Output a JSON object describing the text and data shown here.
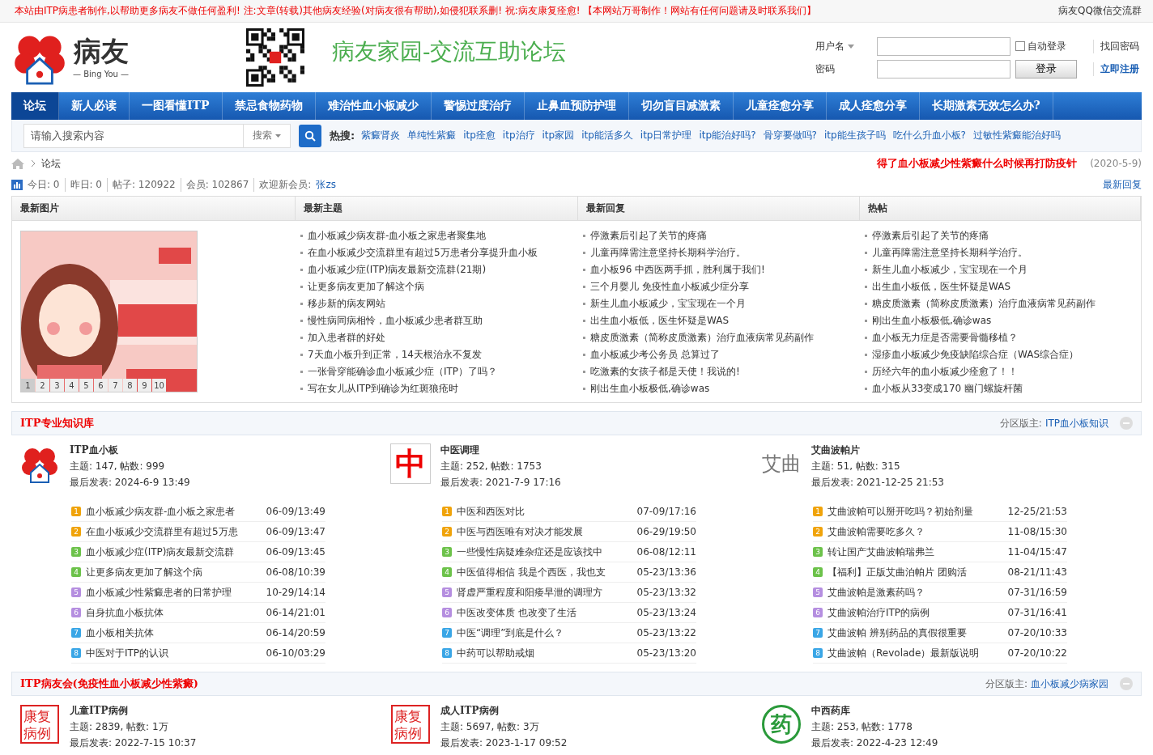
{
  "top_notice": "本站由ITP病患者制作,以帮助更多病友不做任何盈利! 注:文章(转载)其他病友经验(对病友很有帮助),如侵犯联系删! 祝:病友康复痊愈! 【本网站万哥制作！网站有任何问题请及时联系我们】",
  "top_link": "病友QQ微信交流群",
  "logo": {
    "name": "病友",
    "sub": "— Bing You —"
  },
  "site_title": "病友家园-交流互助论坛",
  "login": {
    "user_label": "用户名",
    "pass_label": "密码",
    "auto_login": "自动登录",
    "auto_checked": false,
    "submit": "登录",
    "forgot": "找回密码",
    "register": "立即注册"
  },
  "nav": [
    {
      "label": "论坛",
      "selected": true
    },
    {
      "label": "新人必读",
      "selected": false
    },
    {
      "label": "一图看懂ITP",
      "selected": false
    },
    {
      "label": "禁忌食物药物",
      "selected": false
    },
    {
      "label": "难治性血小板减少",
      "selected": false
    },
    {
      "label": "警惕过度治疗",
      "selected": false
    },
    {
      "label": "止鼻血预防护理",
      "selected": false
    },
    {
      "label": "切勿盲目减激素",
      "selected": false
    },
    {
      "label": "儿童痊愈分享",
      "selected": false
    },
    {
      "label": "成人痊愈分享",
      "selected": false
    },
    {
      "label": "长期激素无效怎么办?",
      "selected": false
    }
  ],
  "search": {
    "placeholder": "请输入搜索内容",
    "scope": "搜索",
    "hot_label": "热搜:",
    "hot": [
      "紫癜肾炎",
      "单纯性紫癜",
      "itp痊愈",
      "itp治疗",
      "itp家园",
      "itp能活多久",
      "itp日常护理",
      "itp能治好吗?",
      "骨穿要做吗?",
      "itp能生孩子吗",
      "吃什么升血小板?",
      "过敏性紫癜能治好吗"
    ]
  },
  "breadcrumb": {
    "current": "论坛",
    "headline": "得了血小板减少性紫癜什么时候再打防疫针",
    "headline_date": "(2020-5-9)"
  },
  "stats": [
    "今日: 0",
    "昨日: 0",
    "帖子: 120922",
    "会员: 102867"
  ],
  "new_member_label": "欢迎新会员:",
  "new_member": "张zs",
  "latest_replies_link": "最新回复",
  "latest": {
    "columns": [
      "最新图片",
      "最新主题",
      "最新回复",
      "热帖"
    ],
    "pager": [
      {
        "label": "1",
        "selected": true
      },
      {
        "label": "2",
        "selected": false
      },
      {
        "label": "3",
        "selected": false
      },
      {
        "label": "4",
        "selected": false
      },
      {
        "label": "5",
        "selected": false
      },
      {
        "label": "6",
        "selected": false
      },
      {
        "label": "7",
        "selected": false
      },
      {
        "label": "8",
        "selected": false
      },
      {
        "label": "9",
        "selected": false
      },
      {
        "label": "10",
        "selected": false
      }
    ],
    "lists": [
      [
        "血小板减少病友群-血小板之家患者聚集地",
        "在血小板减少交流群里有超过5万患者分享提升血小板",
        "血小板减少症(ITP)病友最新交流群(21期)",
        "让更多病友更加了解这个病",
        "移步新的病友网站",
        "慢性病同病相怜，血小板减少患者群互助",
        "加入患者群的好处",
        "7天血小板升到正常，14天根治永不复发",
        "一张骨穿能确诊血小板减少症（ITP）了吗？",
        "写在女儿从ITP到确诊为红斑狼疮时"
      ],
      [
        "停激素后引起了关节的疼痛",
        "儿童再障需注意坚持长期科学治疗。",
        "血小板96 中西医两手抓，胜利属于我们!",
        "三个月婴儿 免疫性血小板减少症分享",
        "新生儿血小板减少，宝宝现在一个月",
        "出生血小板低，医生怀疑是WAS",
        "糖皮质激素（简称皮质激素）治疗血液病常见药副作",
        "血小板减少考公务员 总算过了",
        "吃激素的女孩子都是天使！我说的!",
        "刚出生血小板极低,确诊was"
      ],
      [
        "停激素后引起了关节的疼痛",
        "儿童再障需注意坚持长期科学治疗。",
        "新生儿血小板减少，宝宝现在一个月",
        "出生血小板低，医生怀疑是WAS",
        "糖皮质激素（简称皮质激素）治疗血液病常见药副作",
        "刚出生血小板极低,确诊was",
        "血小板无力症是否需要骨髓移植？",
        "湿疹血小板减少免疫缺陷综合症（WAS综合症）",
        "历经六年的血小板减少痊愈了！！",
        "血小板从33变成170 幽门螺旋杆菌"
      ]
    ]
  },
  "sections": [
    {
      "title": "ITP专业知识库",
      "moderator_label": "分区版主:",
      "moderator": "ITP血小板知识",
      "forums": [
        {
          "icon": {
            "kind": "logo"
          },
          "name": "ITP血小板",
          "stats": "主题: 147, 帖数: 999",
          "last": "最后发表: 2024-6-9 13:49",
          "threads": [
            {
              "rank": "1",
              "color": "#f0a30a",
              "title": "血小板减少病友群-血小板之家患者",
              "time": "06-09/13:49"
            },
            {
              "rank": "2",
              "color": "#f0a30a",
              "title": "在血小板减少交流群里有超过5万患",
              "time": "06-09/13:47"
            },
            {
              "rank": "3",
              "color": "#6cc24a",
              "title": "血小板减少症(ITP)病友最新交流群",
              "time": "06-09/13:45"
            },
            {
              "rank": "4",
              "color": "#6cc24a",
              "title": "让更多病友更加了解这个病",
              "time": "06-08/10:39"
            },
            {
              "rank": "5",
              "color": "#b58ee0",
              "title": "血小板减少性紫癜患者的日常护理",
              "time": "10-29/14:14"
            },
            {
              "rank": "6",
              "color": "#b58ee0",
              "title": "自身抗血小板抗体",
              "time": "06-14/21:01"
            },
            {
              "rank": "7",
              "color": "#3aa6e6",
              "title": "血小板相关抗体",
              "time": "06-14/20:59"
            },
            {
              "rank": "8",
              "color": "#3aa6e6",
              "title": "中医对于ITP的认识",
              "time": "06-10/03:29"
            }
          ]
        },
        {
          "icon": {
            "kind": "tile",
            "text": "中"
          },
          "name": "中医调理",
          "stats": "主题: 252, 帖数: 1753",
          "last": "最后发表: 2021-7-9 17:16",
          "threads": [
            {
              "rank": "1",
              "color": "#f0a30a",
              "title": "中医和西医对比",
              "time": "07-09/17:16"
            },
            {
              "rank": "2",
              "color": "#f0a30a",
              "title": "中医与西医唯有对决才能发展",
              "time": "06-29/19:50"
            },
            {
              "rank": "3",
              "color": "#6cc24a",
              "title": "一些慢性病疑难杂症还是应该找中",
              "time": "06-08/12:11"
            },
            {
              "rank": "4",
              "color": "#6cc24a",
              "title": "中医值得相信 我是个西医，我也支",
              "time": "05-23/13:36"
            },
            {
              "rank": "5",
              "color": "#b58ee0",
              "title": "肾虚严重程度和阳痿早泄的调理方",
              "time": "05-23/13:32"
            },
            {
              "rank": "6",
              "color": "#b58ee0",
              "title": "中医改变体质 也改变了生活",
              "time": "05-23/13:24"
            },
            {
              "rank": "7",
              "color": "#3aa6e6",
              "title": "中医“调理”到底是什么？",
              "time": "05-23/13:22"
            },
            {
              "rank": "8",
              "color": "#3aa6e6",
              "title": "中药可以帮助戒烟",
              "time": "05-23/13:20"
            }
          ]
        },
        {
          "icon": {
            "kind": "plain",
            "text": "艾曲"
          },
          "name": "艾曲波帕片",
          "stats": "主题: 51, 帖数: 315",
          "last": "最后发表: 2021-12-25 21:53",
          "threads": [
            {
              "rank": "1",
              "color": "#f0a30a",
              "title": "艾曲波帕可以掰开吃吗？初始剂量",
              "time": "12-25/21:53"
            },
            {
              "rank": "2",
              "color": "#f0a30a",
              "title": "艾曲波帕需要吃多久？",
              "time": "11-08/15:30"
            },
            {
              "rank": "3",
              "color": "#6cc24a",
              "title": "转让国产艾曲波帕瑞弗兰",
              "time": "11-04/15:47"
            },
            {
              "rank": "4",
              "color": "#6cc24a",
              "title": "【福利】正版艾曲泊帕片 团购活",
              "time": "08-21/11:43"
            },
            {
              "rank": "5",
              "color": "#b58ee0",
              "title": "艾曲波帕是激素药吗？",
              "time": "07-31/16:59"
            },
            {
              "rank": "6",
              "color": "#b58ee0",
              "title": "艾曲波帕治疗ITP的病例",
              "time": "07-31/16:41"
            },
            {
              "rank": "7",
              "color": "#3aa6e6",
              "title": "艾曲波帕 辨别药品的真假很重要",
              "time": "07-20/10:33"
            },
            {
              "rank": "8",
              "color": "#3aa6e6",
              "title": "艾曲波帕（Revolade）最新版说明",
              "time": "07-20/10:22"
            }
          ]
        }
      ]
    },
    {
      "title": "ITP病友会(免疫性血小板减少性紫癜)",
      "moderator_label": "分区版主:",
      "moderator": "血小板减少病家园",
      "forums": [
        {
          "icon": {
            "kind": "stamp",
            "text": "康复病例"
          },
          "name": "儿童ITP病例",
          "stats": "主题: 2839, 帖数: 1万",
          "last": "最后发表: 2022-7-15 10:37"
        },
        {
          "icon": {
            "kind": "stamp",
            "text": "康复病例"
          },
          "name": "成人ITP病例",
          "stats": "主题: 5697, 帖数: 3万",
          "last": "最后发表: 2023-1-17 09:52"
        },
        {
          "icon": {
            "kind": "seal",
            "text": "药"
          },
          "name": "中西药库",
          "stats": "主题: 253, 帖数: 1778",
          "last": "最后发表: 2022-4-23 12:49"
        }
      ]
    }
  ]
}
